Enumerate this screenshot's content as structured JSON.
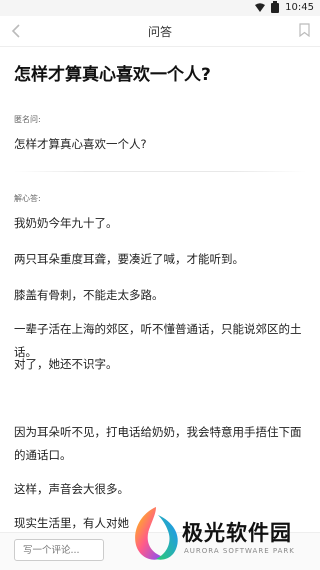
{
  "status_bar": {
    "time": "10:45"
  },
  "nav": {
    "title": "问答"
  },
  "question": {
    "title": "怎样才算真心喜欢一个人?",
    "asker_label": "匿名问:",
    "body": "怎样才算真心喜欢一个人?"
  },
  "answer": {
    "answerer_label": "解心答:",
    "paragraphs": [
      "我奶奶今年九十了。",
      "两只耳朵重度耳聋，要凑近了喊，才能听到。",
      "膝盖有骨刺，不能走太多路。",
      "一辈子活在上海的郊区，听不懂普通话，只能说郊区的土话。",
      "对了，她还不识字。",
      "因为耳朵听不见，打电话给奶奶，我会特意用手捂住下面的通话口。",
      "这样，声音会大很多。",
      "现实生活里，有人对她"
    ]
  },
  "comment": {
    "placeholder": "写一个评论..."
  },
  "watermark": {
    "title": "极光软件园",
    "subtitle": "AURORA SOFTWARE PARK"
  }
}
